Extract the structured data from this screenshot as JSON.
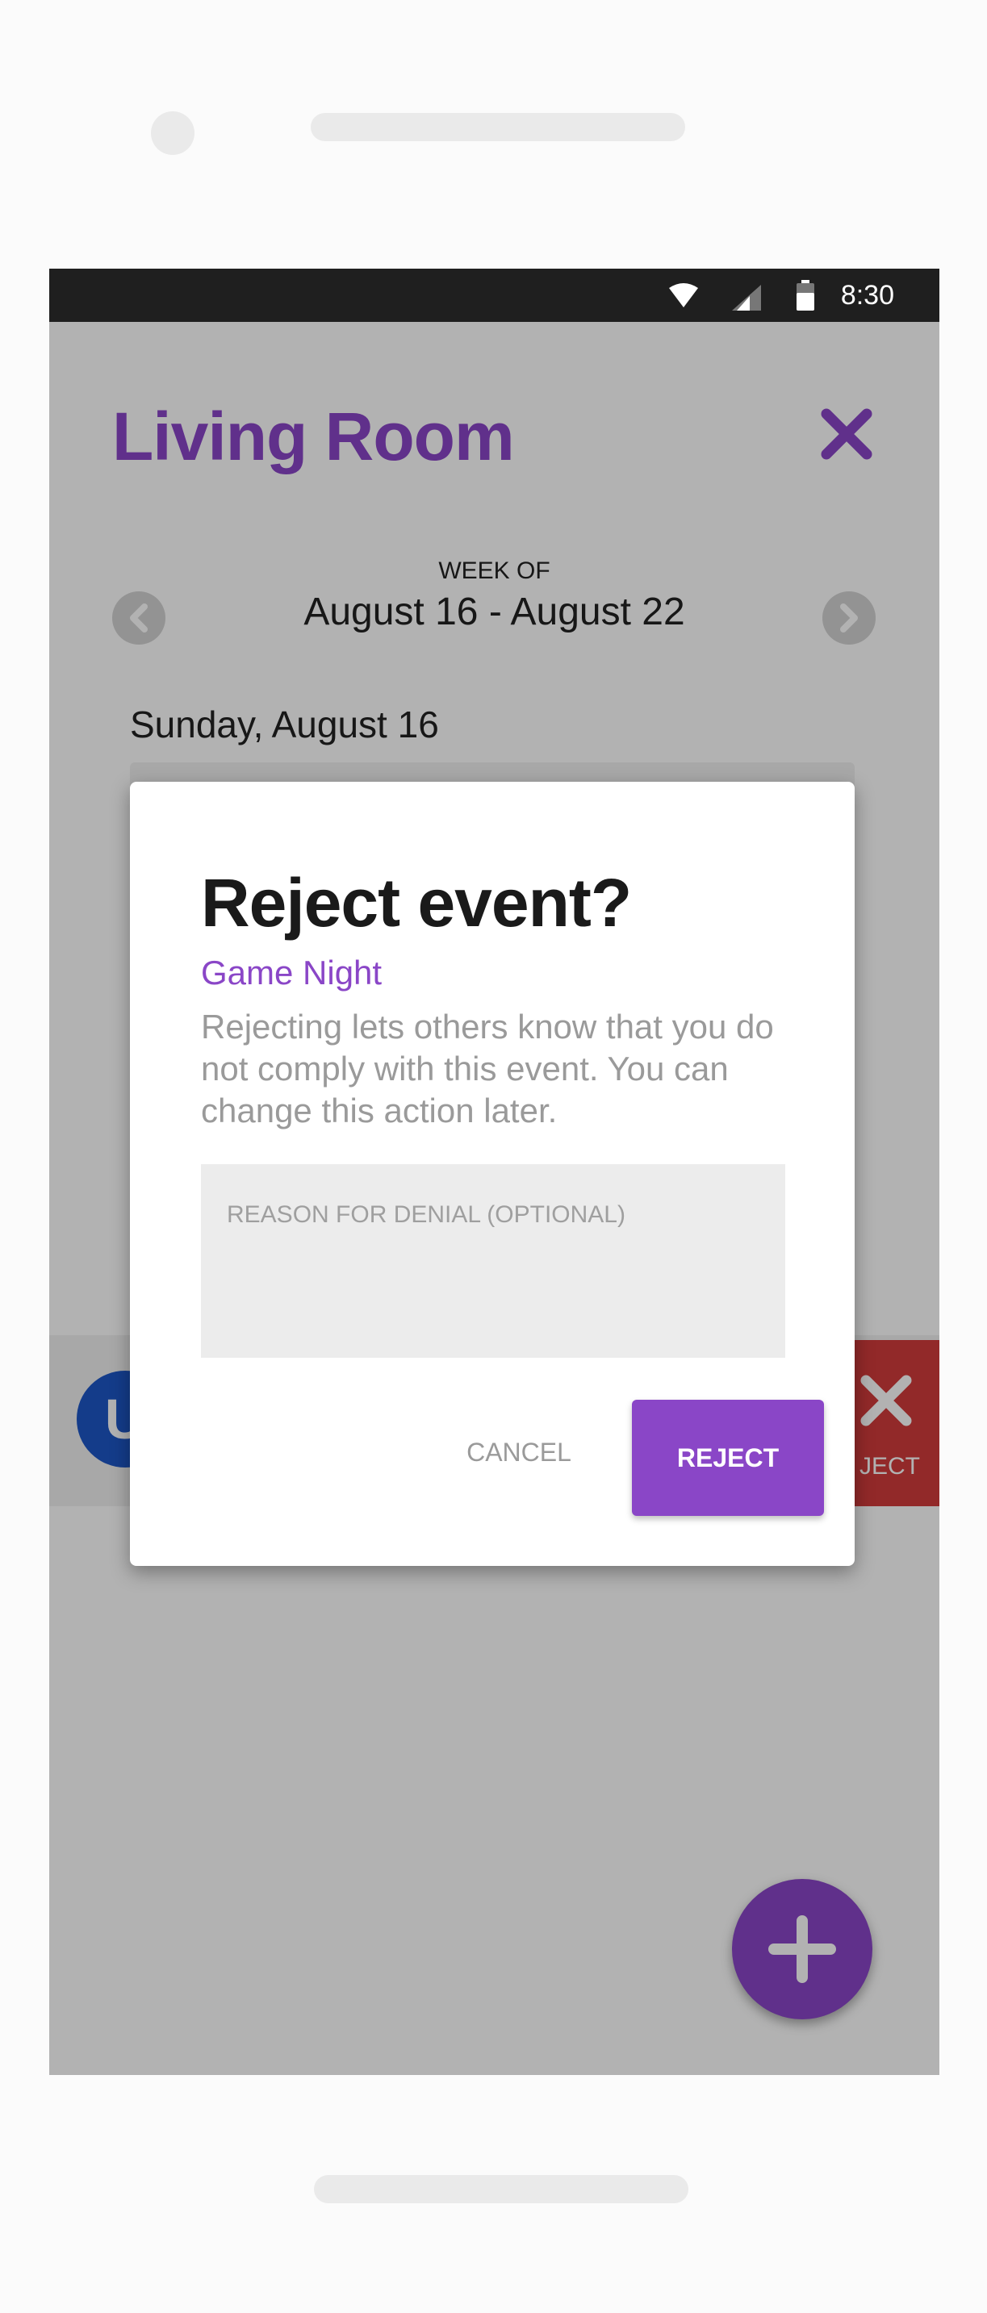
{
  "status_bar": {
    "time": "8:30"
  },
  "header": {
    "title": "Living Room"
  },
  "week": {
    "caption": "WEEK OF",
    "range": "August 16 - August 22"
  },
  "schedule": {
    "day_label": "Sunday, August 16"
  },
  "background_row": {
    "avatar_letter": "U",
    "reject_label": "JECT"
  },
  "dialog": {
    "title": "Reject event?",
    "event_name": "Game Night",
    "description": "Rejecting lets others know that you do not comply with this event. You can change this action later.",
    "reason_placeholder": "REASON FOR DENIAL (OPTIONAL)",
    "cancel_label": "CANCEL",
    "reject_label": "REJECT"
  },
  "colors": {
    "accent": "#8a46c7",
    "reject_red": "#d23c3c",
    "avatar_blue": "#1e57c6"
  }
}
